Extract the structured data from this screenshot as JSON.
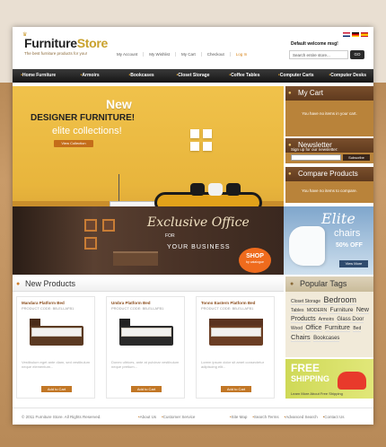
{
  "header": {
    "brand_part1": "Furniture",
    "brand_part2": "Store",
    "slogan": "The best furniture products for you!",
    "welcome": "Default welcome msg!",
    "top_links": [
      "My Account",
      "My Wishlist",
      "My Cart",
      "Checkout",
      "Log In"
    ],
    "search": {
      "placeholder": "Search entire store...",
      "button": "GO"
    }
  },
  "menu": {
    "items": [
      "Home Furniture",
      "Armoirs",
      "Bookcases",
      "Closet Storage",
      "Coffee Tables",
      "Computer Carts",
      "Computer Desks"
    ]
  },
  "hero": {
    "new": "New",
    "designer": "DESIGNER FURNITURE!",
    "elite": "elite collections!",
    "button": "View Collection"
  },
  "banner_office": {
    "title": "Exclusive Office",
    "for": "FOR",
    "sub": "YOUR BUSINESS",
    "shop": "SHOP",
    "shop_sub": "by catalogue"
  },
  "banner_elite": {
    "title": "Elite",
    "chairs": "chairs",
    "offer": "50% OFF",
    "button": "View More"
  },
  "sidebar": {
    "cart": {
      "title": "My Cart",
      "text": "You have no items in your cart."
    },
    "newsletter": {
      "title": "Newsletter",
      "label": "Sign up for our newsletter:",
      "button": "Subscribe"
    },
    "compare": {
      "title": "Compare Products",
      "text": "You have no items to compare."
    }
  },
  "new_products": {
    "title": "New Products",
    "items": [
      {
        "name": "Mandara Platform Bed",
        "code": "PRODUCT CODE: BB-ELLAFB1",
        "desc": "Vestibulum eget ante diam, sed vestibulum neque elementum...",
        "button": "Add to Cart"
      },
      {
        "name": "Umbra Platform Bed",
        "code": "PRODUCT CODE: BB-ELLAFB1",
        "desc": "Donec ultrices, ante at pulvinar vestibulum neque pretium...",
        "button": "Add to Cart"
      },
      {
        "name": "Tonno Eastern Platform Bed",
        "code": "PRODUCT CODE: BB-ELLAFB1",
        "desc": "Lorem ipsum dolor sit amet consectetur adipiscing elit...",
        "button": "Add to Cart"
      }
    ]
  },
  "tags": {
    "title": "Popular Tags",
    "items": [
      "Closet Storage",
      "Bedroom",
      "Tables",
      "MODERN",
      "Furniture",
      "New Products",
      "Armoirs",
      "Glass Door",
      "Wood",
      "Office",
      "Furniture",
      "Bed",
      "Chairs",
      "Bookcases"
    ]
  },
  "freeship": {
    "line1": "FREE",
    "line2": "SHIPPING",
    "link": "Learn More About Free Shipping"
  },
  "footer": {
    "copyright": "© 2011 Furniture Store. All Rights Reserved.",
    "links1": [
      "About Us",
      "Customer Service"
    ],
    "links2": [
      "Site Map",
      "Search Terms",
      "Advanced Search",
      "Contact Us"
    ]
  },
  "colors": {
    "accent": "#c27726",
    "brand_gold": "#c9a12c",
    "menu_bg": "#1e1e1e",
    "sidebar_brown": "#b9833a"
  }
}
